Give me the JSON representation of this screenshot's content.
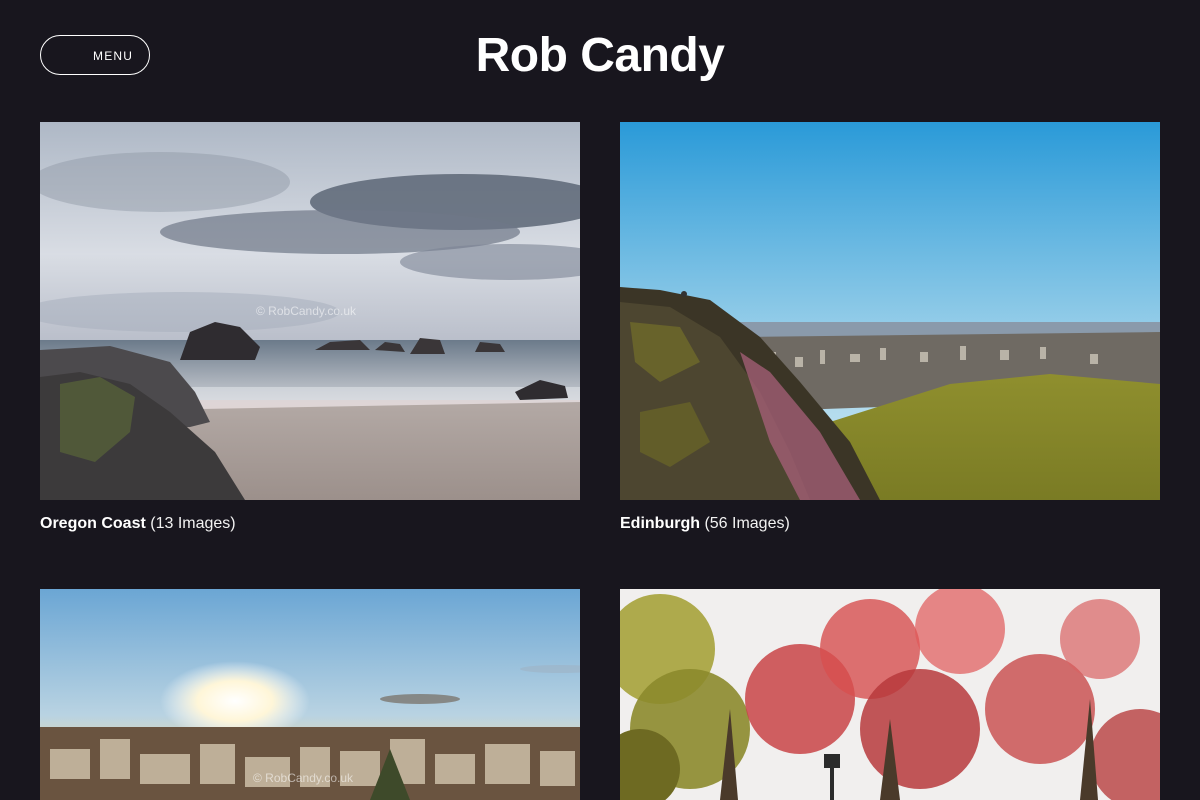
{
  "header": {
    "menu_label": "MENU",
    "title": "Rob Candy"
  },
  "galleries": [
    {
      "name": "Oregon Coast",
      "count": "(13 Images)",
      "watermark": "© RobCandy.co.uk"
    },
    {
      "name": "Edinburgh",
      "count": "(56 Images)"
    },
    {
      "name": "",
      "count": "",
      "watermark": "© RobCandy.co.uk"
    },
    {
      "name": "",
      "count": ""
    }
  ]
}
